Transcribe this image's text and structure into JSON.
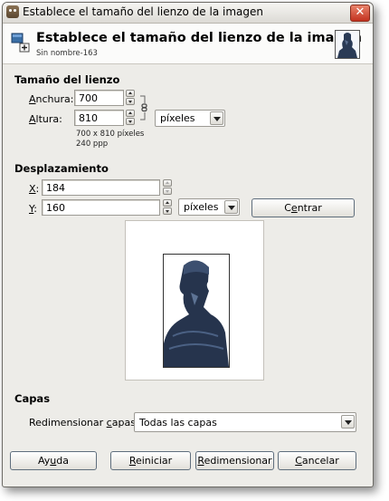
{
  "window": {
    "title": "Establece el tamaño del lienzo de la imagen",
    "close": "✕"
  },
  "header": {
    "title": "Establece el tamaño del lienzo de la imagen",
    "subtitle": "Sin nombre-163"
  },
  "canvas_size": {
    "section": "Tamaño del lienzo",
    "width_label_mnemonic": "A",
    "width_label_rest": "nchura:",
    "width_value": "700",
    "height_label_mnemonic": "A",
    "height_label_rest": "ltura:",
    "height_value": "810",
    "unit": "píxeles",
    "info_size": "700 x 810 píxeles",
    "info_res": "240 ppp"
  },
  "offset": {
    "section": "Desplazamiento",
    "x_label_mnemonic": "X",
    "x_label_rest": ":",
    "x_value": "184",
    "y_label_mnemonic": "Y",
    "y_label_rest": ":",
    "y_value": "160",
    "unit": "píxeles",
    "center_button_pre": "C",
    "center_button_mnemonic": "e",
    "center_button_post": "ntrar"
  },
  "layers": {
    "section": "Capas",
    "resize_label_pre": "Redimensionar ",
    "resize_label_mnemonic": "c",
    "resize_label_post": "apas:",
    "resize_value": "Todas las capas"
  },
  "buttons": {
    "help_pre": "Ay",
    "help_mnemonic": "u",
    "help_post": "da",
    "reset_mnemonic": "R",
    "reset_post": "einiciar",
    "resize_mnemonic": "R",
    "resize_post": "edimensionar",
    "cancel_mnemonic": "C",
    "cancel_post": "ancelar"
  }
}
